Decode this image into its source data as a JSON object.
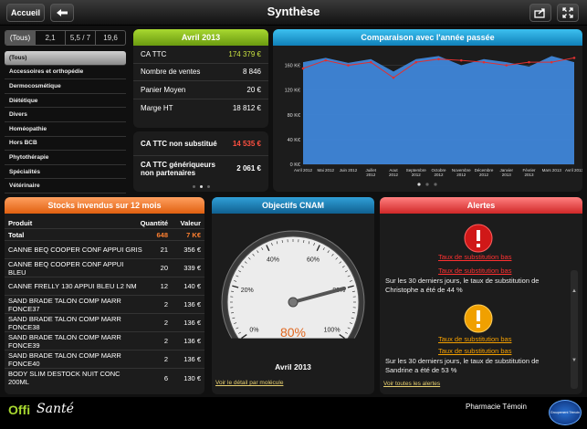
{
  "topbar": {
    "home_label": "Accueil",
    "title": "Synthèse"
  },
  "period_tabs": [
    "(Tous)",
    "2,1",
    "5,5 / 7",
    "19,6"
  ],
  "categories": [
    "(Tous)",
    "Accessoires et orthopédie",
    "Dermocosmétique",
    "Diététique",
    "Divers",
    "Homéopathie",
    "Hors BCB",
    "Phytothérapie",
    "Spécialités",
    "Vétérinaire"
  ],
  "year_panel": {
    "title": "Avril 2013",
    "rows": [
      {
        "label": "CA TTC",
        "value": "174 379 €"
      },
      {
        "label": "Nombre de ventes",
        "value": "8 846"
      },
      {
        "label": "Panier Moyen",
        "value": "20 €"
      },
      {
        "label": "Marge HT",
        "value": "18 812 €"
      }
    ],
    "rows2": [
      {
        "label": "CA TTC non substitué",
        "value": "14 535 €"
      },
      {
        "label": "CA TTC génériqueurs non partenaires",
        "value": "2 061 €"
      }
    ]
  },
  "comparison": {
    "title": "Comparaison avec l'année passée"
  },
  "chart_data": {
    "type": "area",
    "title": "Comparaison avec l'année passée",
    "categories": [
      "Avril 2012",
      "Mai 2012",
      "Juin 2012",
      "Juillet 2012",
      "Aout 2012",
      "Septembre 2012",
      "Octobre 2012",
      "Novembre 2012",
      "Décembre 2012",
      "Janvier 2013",
      "Février 2013",
      "Mars 2013",
      "Avril 2013"
    ],
    "yticks": [
      "0 K€",
      "40 K€",
      "80 K€",
      "120 K€",
      "160 K€"
    ],
    "ylim": [
      0,
      180
    ],
    "series": [
      {
        "values": [
          165,
          172,
          164,
          170,
          150,
          170,
          175,
          160,
          170,
          165,
          158,
          175,
          165
        ],
        "color": "#3f86d9"
      },
      {
        "values": [
          155,
          168,
          160,
          165,
          140,
          165,
          170,
          168,
          165,
          160,
          165,
          165,
          172
        ],
        "color": "#e03030"
      }
    ]
  },
  "stocks": {
    "title": "Stocks invendus sur 12 mois",
    "headers": [
      "Produit",
      "Quantité",
      "Valeur"
    ],
    "total": {
      "label": "Total",
      "qty": "648",
      "value": "7 K€"
    },
    "rows": [
      {
        "p": "CANNE BEQ COOPER CONF APPUI GRIS",
        "q": "21",
        "v": "356 €"
      },
      {
        "p": "CANNE BEQ COOPER CONF APPUI BLEU",
        "q": "20",
        "v": "339 €"
      },
      {
        "p": "CANNE FRELLY 130 APPUI BLEU L2 NM",
        "q": "12",
        "v": "140 €"
      },
      {
        "p": "SAND BRADE TALON COMP MARR FONCE37",
        "q": "2",
        "v": "136 €"
      },
      {
        "p": "SAND BRADE TALON COMP MARR FONCE38",
        "q": "2",
        "v": "136 €"
      },
      {
        "p": "SAND BRADE TALON COMP MARR FONCE39",
        "q": "2",
        "v": "136 €"
      },
      {
        "p": "SAND BRADE TALON COMP MARR FONCE40",
        "q": "2",
        "v": "136 €"
      },
      {
        "p": "BODY SLIM DESTOCK NUIT CONC 200ML",
        "q": "6",
        "v": "130 €"
      }
    ]
  },
  "cnam": {
    "title": "Objectifs CNAM",
    "gauge_labels": [
      "0%",
      "20%",
      "40%",
      "60%",
      "80%",
      "100%"
    ],
    "value_label": "80%",
    "gauge_level": 0.8,
    "period": "Avril 2013",
    "link": "Voir le détail par molécule"
  },
  "alerts": {
    "title": "Alertes",
    "items": [
      {
        "link1": "Taux de substitution bas",
        "link2": "Taux de substitution bas",
        "text": "Sur les 30 derniers jours, le taux de substitution de Christophe a été de 44 %",
        "color": "#e03030"
      },
      {
        "link1": "Taux de substitution bas",
        "link2": "Taux de substitution bas",
        "text": "Sur les 30 derniers jours, le taux de substitution de Sandrine a été de 53 %",
        "color": "#f5a000"
      }
    ],
    "link": "Voir toutes les alertes"
  },
  "footer": {
    "logo_a": "Offi",
    "logo_b": "Santé",
    "pharmacy": "Pharmacie Témoin",
    "badge": "Groupement Témoin"
  }
}
